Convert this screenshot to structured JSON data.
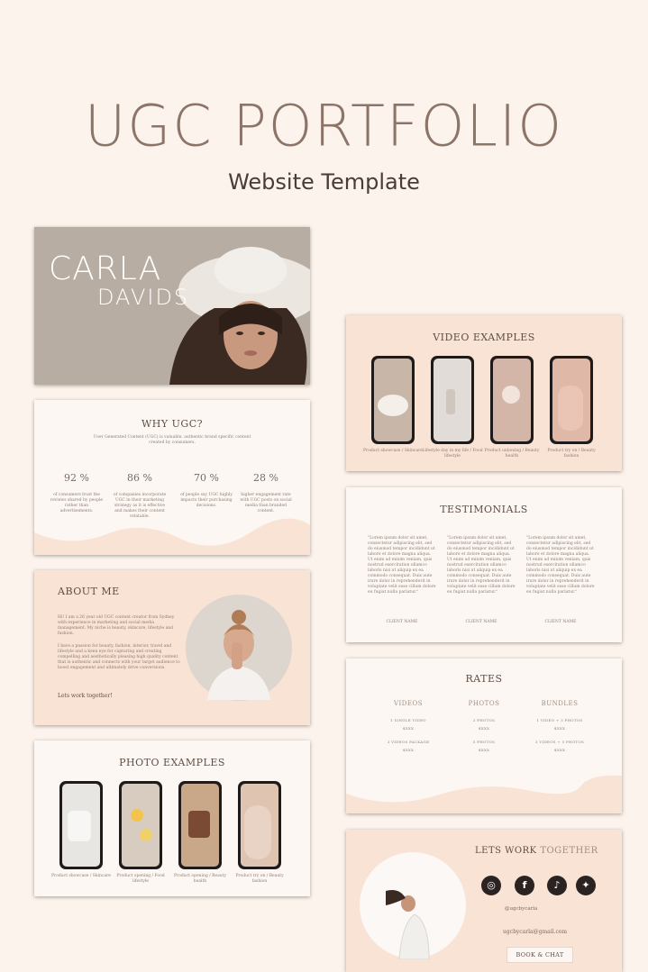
{
  "header": {
    "title": "UGC PORTFOLIO",
    "subtitle": "Website Template"
  },
  "carla": {
    "first": "CARLA",
    "last": "DAVIDS"
  },
  "why": {
    "title": "WHY UGC?",
    "intro": "User Generated Content (UGC) is valuable, authentic brand specific content created by consumers.",
    "stats": [
      {
        "value": "92 %",
        "text": "of consumers trust the reviews shared by people rather than advertisements."
      },
      {
        "value": "86 %",
        "text": "of companies incorporate UGC in their marketing strategy as it is effective and makes their content relatable."
      },
      {
        "value": "70 %",
        "text": "of people say UGC highly impacts their purchasing decisions."
      },
      {
        "value": "28 %",
        "text": "higher engagement rate with UGC posts on social media than branded content."
      }
    ]
  },
  "about": {
    "title": "ABOUT ME",
    "p1": "Hi! I am a 26 year old UGC content creator from Sydney with experience in marketing and social media management. My niche is beauty, skincare, lifestyle and fashion.",
    "p2": "I have a passion for beauty, fashion, interior, travel and lifestyle and a keen eye for capturing and creating compelling and aesthetically pleasing high quality content that is authentic and connects with your target audience to boost engagement and ultimately drive conversions.",
    "cta": "Lets work together!"
  },
  "photos": {
    "title": "PHOTO EXAMPLES",
    "items": [
      {
        "caption": "Product showcase / Skincare"
      },
      {
        "caption": "Product opening / Food lifestyle"
      },
      {
        "caption": "Product opening / Beauty health"
      },
      {
        "caption": "Product try on / Beauty fashion"
      }
    ]
  },
  "videos": {
    "title": "VIDEO EXAMPLES",
    "items": [
      {
        "caption": "Product showcase / Skincare"
      },
      {
        "caption": "Lifestyle day in my life / Food lifestyle"
      },
      {
        "caption": "Product unboxing / Beauty health"
      },
      {
        "caption": "Product try on / Beauty fashion"
      }
    ]
  },
  "testimonials": {
    "title": "TESTIMONIALS",
    "quote": "\"Lorem ipsum dolor sit amet, consectetur adipiscing elit, sed do eiusmod tempor incididunt ut labore et dolore magna aliqua. Ut enim ad minim veniam, quis nostrud exercitation ullamco laboris nisi ut aliquip ex ea commodo consequat. Duis aute irure dolor in reprehenderit in voluptate velit esse cillum dolore eu fugiat nulla pariatur.\"",
    "client": "CLIENT NAME"
  },
  "rates": {
    "title": "RATES",
    "columns": [
      {
        "title": "VIDEOS",
        "line1": "1 SINGLE VIDEO",
        "price1": "$XXX",
        "line2": "3 VIDEOS PACKAGE",
        "price2": "$XXX"
      },
      {
        "title": "PHOTOS",
        "line1": "3 PHOTOS",
        "price1": "$XXX",
        "line2": "5 PHOTOS",
        "price2": "$XXX"
      },
      {
        "title": "BUNDLES",
        "line1": "1 VIDEO + 3 PHOTOS",
        "price1": "$XXX",
        "line2": "3 VIDEOS + 5 PHOTOS",
        "price2": "$XXX"
      }
    ]
  },
  "contact": {
    "title_a": "LETS WORK",
    "title_b": "TOGETHER",
    "handle": "@ugcbycarla",
    "email": "ugcbycarla@gmail.com",
    "button": "BOOK & CHAT",
    "socials": [
      {
        "icon": "instagram-icon",
        "glyph": "◎"
      },
      {
        "icon": "facebook-icon",
        "glyph": "f"
      },
      {
        "icon": "tiktok-icon",
        "glyph": "♪"
      },
      {
        "icon": "twitter-icon",
        "glyph": "✦"
      }
    ]
  },
  "colors": {
    "background": "#fcf4ec",
    "peach": "#f8e3d5",
    "cream": "#fdf7f3",
    "title": "#8c7568"
  }
}
